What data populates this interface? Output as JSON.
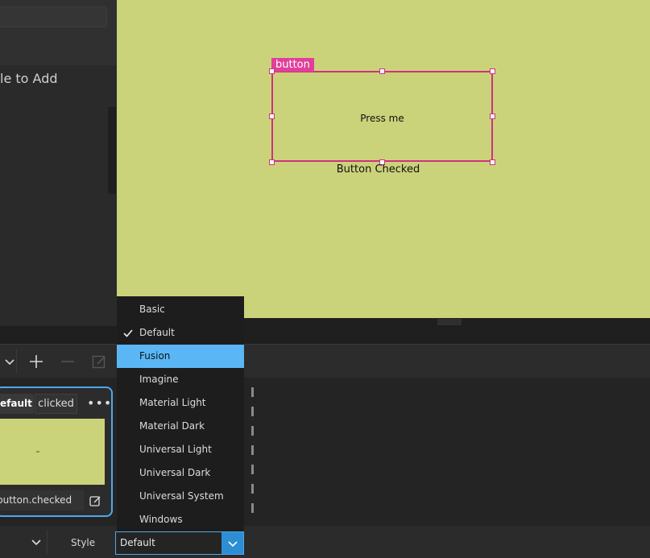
{
  "left_panel": {
    "hint_text": "le to Add"
  },
  "canvas": {
    "selection_tag": "button",
    "button_text": "Press me",
    "status_text": "Button Checked",
    "background_color": "#cbd37a"
  },
  "toolbar": {
    "icons": [
      "chevron-down-icon",
      "plus-icon",
      "minus-icon",
      "edit-icon"
    ]
  },
  "state_card": {
    "default_label": "efault",
    "state_label": "clicked",
    "more_label": "•••",
    "when_condition": "button.checked",
    "accent": "#4fa9ea"
  },
  "properties": {
    "style_label": "Style",
    "style_value": "Default"
  },
  "style_popup": {
    "items": [
      "Basic",
      "Default",
      "Fusion",
      "Imagine",
      "Material Light",
      "Material Dark",
      "Universal Light",
      "Universal Dark",
      "Universal System",
      "Windows"
    ],
    "checked": "Default",
    "highlighted": "Fusion",
    "highlight_color": "#5bb6f6"
  }
}
